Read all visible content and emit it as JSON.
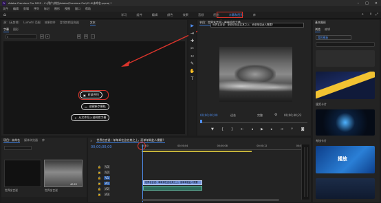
{
  "titlebar": {
    "title": "Adobe Premiere Pro 2022 - C:\\用户\\文档\\Adobe\\Premiere Pro\\22.0\\未命名.prproj *"
  },
  "menubar": {
    "items": [
      "文件",
      "编辑",
      "剪辑",
      "序列",
      "标记",
      "图形",
      "视图",
      "窗口",
      "帮助"
    ]
  },
  "workspaces": {
    "items": [
      "学习",
      "组件",
      "编辑",
      "颜色",
      "效果",
      "音频",
      "图形",
      "字幕和图形",
      "库"
    ],
    "active_index": 7
  },
  "source_panel": {
    "tabs": [
      "源：(无剪辑)",
      "Lumetri 范围",
      "效果控件",
      "音频剪辑混合器"
    ],
    "text_tab": "文本",
    "subtabs": [
      "字幕",
      "图形"
    ],
    "active_subtab": 0,
    "search_placeholder": "",
    "create_caption_button": "转录序列",
    "new_track_button": "创建新字幕轨",
    "import_button": "从文件导入说明性字幕"
  },
  "program_monitor": {
    "tab": "节目：世界名言说 · 单单如此之美",
    "caption_text": "世界名言说：单单却在这名其之上，而单单如此人需要？",
    "timecode_left": "00;00;00;00",
    "fit_label": "适合",
    "quality_label": "完整",
    "timecode_right": "00;00;40;22"
  },
  "essential_graphics": {
    "title": "基本图形",
    "tabs": [
      "浏览",
      "编辑"
    ],
    "dropdown": "我的模板",
    "items": [
      {
        "label": ""
      },
      {
        "label": ""
      },
      {
        "label": "颁奖卡片"
      },
      {
        "label": ""
      },
      {
        "label": "考核卡片"
      },
      {
        "label": ""
      },
      {
        "label": ""
      }
    ],
    "badge_text": "播放"
  },
  "project_panel": {
    "tabs": [
      "项目：未命名",
      "媒体浏览器",
      "库"
    ],
    "items": [
      {
        "label": "世界名言说"
      },
      {
        "label": "世界名言说"
      }
    ],
    "duration": "40:22"
  },
  "timeline": {
    "tab": "世界名言说：单单却在这名其之上，而单单如此人需要？",
    "timecode": "00;00;00;00",
    "ruler_labels": [
      "00;00",
      "00;00;04",
      "00;00;08",
      "00;00;12",
      "00;00;16"
    ],
    "tracks": [
      "V3",
      "V2",
      "V1",
      "A1",
      "A2",
      "A3"
    ],
    "clip_label": "世界名言说：单单却在这名其之上，而单单如此人需要"
  },
  "colors": {
    "accent": "#4f8ef0",
    "red_annotation": "#d9342b",
    "playhead": "#4f8ef0",
    "clip_video": "#6f8fd6",
    "caption_track": "#c4b23a"
  }
}
